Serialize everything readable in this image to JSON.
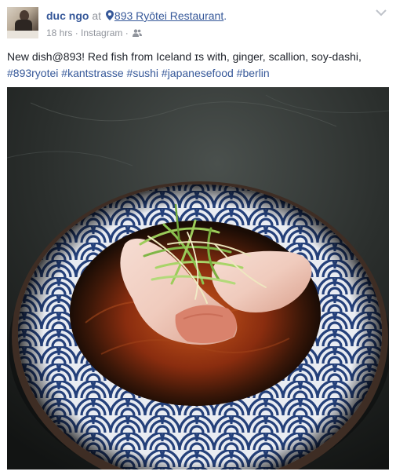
{
  "post": {
    "author": "duc ngo",
    "at_text": "at",
    "place": "893 Ryōtei Restaurant",
    "place_suffix": ".",
    "time": "18 hrs",
    "separator": " · ",
    "source": "Instagram",
    "separator2": " · ",
    "audience_icon": "friends-icon",
    "options_icon": "chevron-down-icon",
    "location_icon": "location-pin-icon"
  },
  "message": {
    "text": "New dish@893! Red fish from Iceland ɪs with, ginger, scallion, soy-dashi,",
    "hashtags": [
      "#893ryotei",
      "#kantstrasse",
      "#sushi",
      "#japanesefood",
      "#berlin"
    ]
  },
  "colors": {
    "link": "#365899",
    "meta": "#90949c",
    "text": "#1d2129",
    "bowl_blue": "#24407a",
    "sauce": "#8a2d0f"
  }
}
